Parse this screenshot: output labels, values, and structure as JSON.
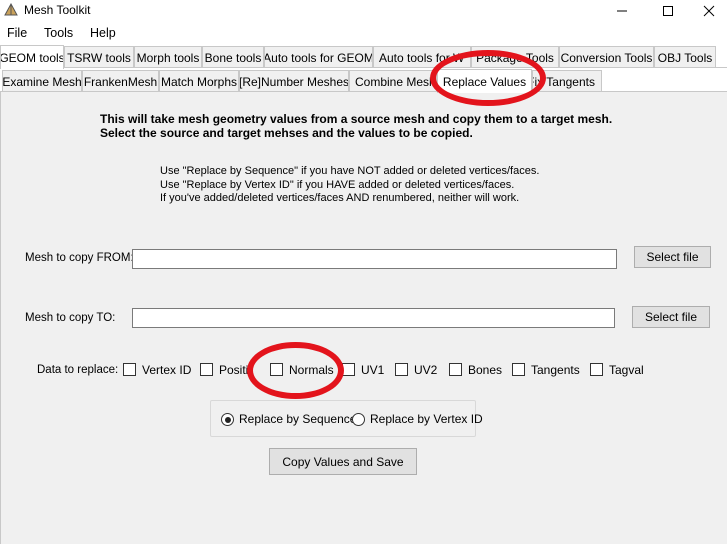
{
  "window": {
    "title": "Mesh Toolkit"
  },
  "menu": {
    "items": [
      "File",
      "Tools",
      "Help"
    ]
  },
  "main_tabs": [
    "GEOM tools",
    "TSRW tools",
    "Morph tools",
    "Bone tools",
    "Auto tools for GEOM",
    "Auto tools for W",
    "Package Tools",
    "Conversion Tools",
    "OBJ Tools"
  ],
  "sub_tabs": [
    "Examine Mesh",
    "FrankenMesh",
    "Match Morphs",
    "[Re]Number Meshes",
    "Combine Meshes",
    "Replace Values",
    "Fix Tangents"
  ],
  "intro": {
    "line1": "This will take mesh geometry values from a source mesh and copy them to a target mesh.",
    "line2": "Select the source and target mehses and the values to be copied."
  },
  "notes": {
    "line1": "Use \"Replace by Sequence\" if you have NOT added or deleted vertices/faces.",
    "line2": "Use \"Replace by Vertex ID\" if you HAVE added or deleted vertices/faces.",
    "line3": "If you've added/deleted vertices/faces AND renumbered, neither will work."
  },
  "from": {
    "label": "Mesh to copy FROM:",
    "value": "",
    "button": "Select file"
  },
  "to": {
    "label": "Mesh to copy TO:",
    "value": "",
    "button": "Select file"
  },
  "data_replace": {
    "label": "Data to replace:",
    "options": [
      "Vertex ID",
      "Position",
      "Normals",
      "UV1",
      "UV2",
      "Bones",
      "Tangents",
      "Tagval"
    ]
  },
  "mode": {
    "sequence": "Replace by Sequence",
    "vertex_id": "Replace by Vertex ID",
    "selected": "Replace by Sequence"
  },
  "action": {
    "button": "Copy Values and Save"
  },
  "annotation_color": "#e3141c"
}
